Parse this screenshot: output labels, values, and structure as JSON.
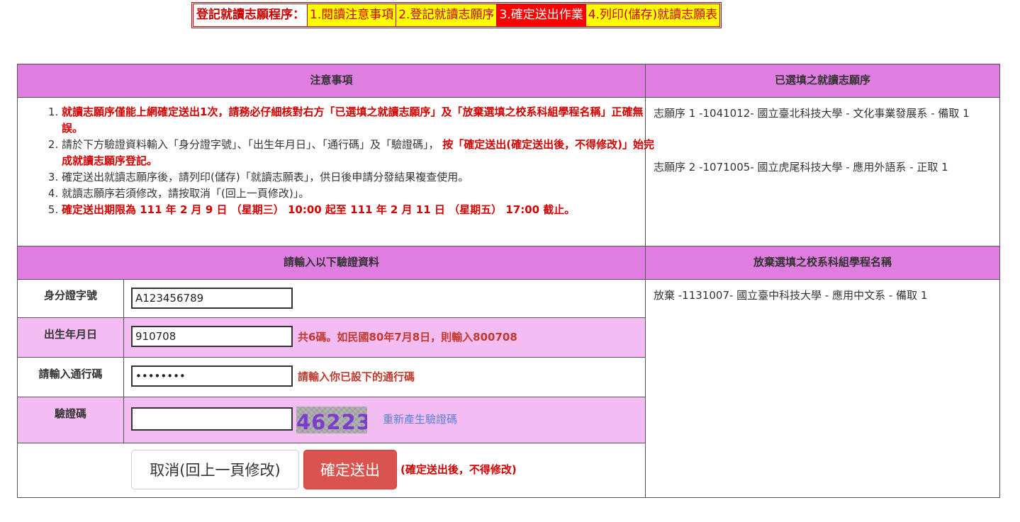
{
  "steps": {
    "title": "登記就讀志願程序：",
    "items": [
      {
        "label": "1.閱讀注意事項"
      },
      {
        "label": "2.登記就讀志願序"
      },
      {
        "label": "3.確定送出作業"
      },
      {
        "label": "4.列印(儲存)就讀志願表"
      }
    ]
  },
  "notes_header": "注意事項",
  "notes": [
    {
      "text": "就讀志願序僅能上網確定送出1次，請務必仔細核對右方「已選填之就讀志願序」及「放棄選填之校系科組學程名稱」正確無誤。"
    },
    {
      "plain": "請於下方驗證資料輸入「身分證字號」、「出生年月日」、「通行碼」及「驗證碼」，",
      "red": "按「確定送出(確定送出後，不得修改)」始完成就讀志願序登記。"
    },
    {
      "text": "確定送出就讀志願序後，請列印(儲存)「就讀志願表」，供日後申請分發結果複查使用。"
    },
    {
      "text": "就讀志願序若須修改，請按取消「(回上一頁修改)」。"
    },
    {
      "text": "確定送出期限為 111 年 2 月 9 日 （星期三） 10:00 起至 111 年 2 月 11 日 （星期五） 17:00 截止。"
    }
  ],
  "chosen_header": "已選填之就讀志願序",
  "chosen": [
    {
      "text": "志願序 1 -1041012- 國立臺北科技大學 - 文化事業發展系 - 備取 1"
    },
    {
      "text": "志願序 2 -1071005- 國立虎尾科技大學 - 應用外語系 - 正取 1"
    }
  ],
  "verify_header": "請輸入以下驗證資料",
  "abandon_header": "放棄選填之校系科組學程名稱",
  "abandon": [
    {
      "text": "放棄 -1131007- 國立臺中科技大學 - 應用中文系 - 備取 1"
    }
  ],
  "form": {
    "id_label": "身分證字號",
    "id_value": "A123456789",
    "birth_label": "出生年月日",
    "birth_value": "910708",
    "birth_hint": "共6碼。如民國80年7月8日，則輸入800708",
    "pass_label": "請輸入通行碼",
    "pass_value": "12345678",
    "pass_hint": "請輸入你已設下的通行碼",
    "captcha_label": "驗證碼",
    "captcha_value": "",
    "captcha_text": "46223",
    "regen_label": "重新產生驗證碼"
  },
  "buttons": {
    "cancel": "取消(回上一頁修改)",
    "confirm": "確定送出",
    "confirm_note": "(確定送出後，不得修改)"
  },
  "colors": {
    "header_bg": "#e07de0",
    "row_pink": "#f3bdf3",
    "step_yellow": "#ffff00",
    "step_active": "#ff0000",
    "alert_red": "#d40000",
    "confirm_btn": "#d9534f"
  }
}
